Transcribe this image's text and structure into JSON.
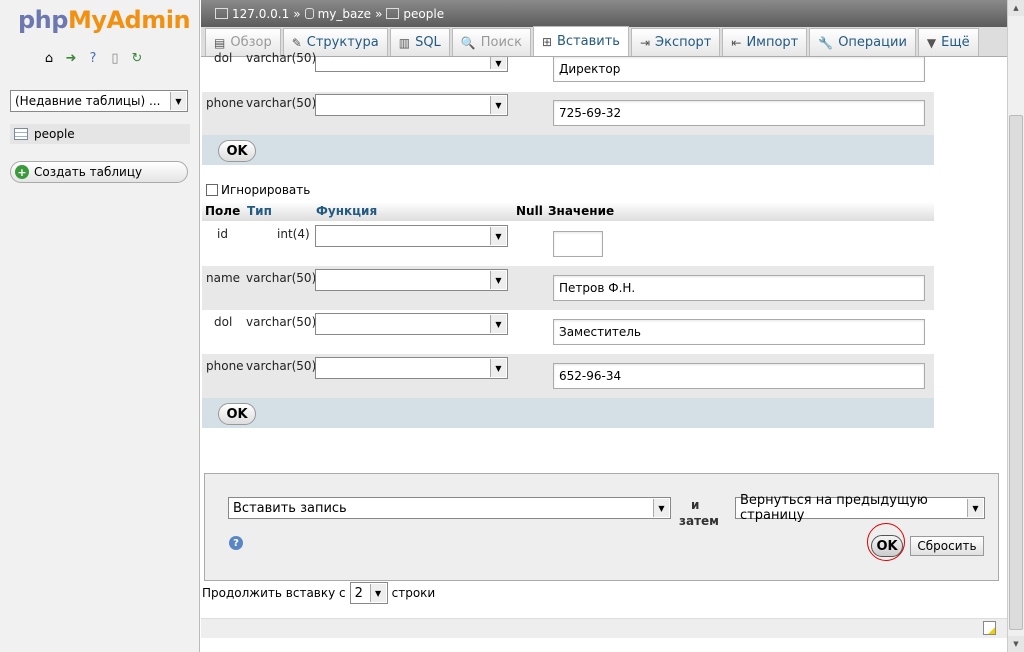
{
  "nav": {
    "logo_php": "php",
    "logo_myadmin": "MyAdmin",
    "recent": "(Недавние таблицы) ...",
    "table": "people",
    "create": "Создать таблицу"
  },
  "crumb": {
    "server": "127.0.0.1",
    "db": "my_baze",
    "table": "people",
    "sep": "»"
  },
  "tabs": [
    {
      "label": "Обзор"
    },
    {
      "label": "Структура"
    },
    {
      "label": "SQL"
    },
    {
      "label": "Поиск"
    },
    {
      "label": "Вставить"
    },
    {
      "label": "Экспорт"
    },
    {
      "label": "Импорт"
    },
    {
      "label": "Операции"
    },
    {
      "label": "Ещё"
    }
  ],
  "form1": {
    "dol": {
      "field": "dol",
      "type": "varchar(50)",
      "value": "Директор"
    },
    "phone": {
      "field": "phone",
      "type": "varchar(50)",
      "value": "725-69-32"
    },
    "ok": "OK"
  },
  "form2": {
    "ignore": "Игнорировать",
    "headers": {
      "field": "Поле",
      "type": "Тип",
      "func": "Функция",
      "null": "Null",
      "value": "Значение"
    },
    "rows": [
      {
        "field": "id",
        "type": "int(4)",
        "value": ""
      },
      {
        "field": "name",
        "type": "varchar(50)",
        "value": "Петров Ф.Н."
      },
      {
        "field": "dol",
        "type": "varchar(50)",
        "value": "Заместитель"
      },
      {
        "field": "phone",
        "type": "varchar(50)",
        "value": "652-96-34"
      }
    ],
    "ok": "OK"
  },
  "footer": {
    "action": "Вставить запись",
    "and": "и",
    "then": "затем",
    "after": "Вернуться на предыдущую страницу",
    "ok": "OK",
    "reset": "Сбросить",
    "continue_prefix": "Продолжить вставку с",
    "continue_count": "2",
    "continue_suffix": "строки"
  },
  "colors": {
    "accent": "#235a81",
    "highlight": "#e00000"
  }
}
